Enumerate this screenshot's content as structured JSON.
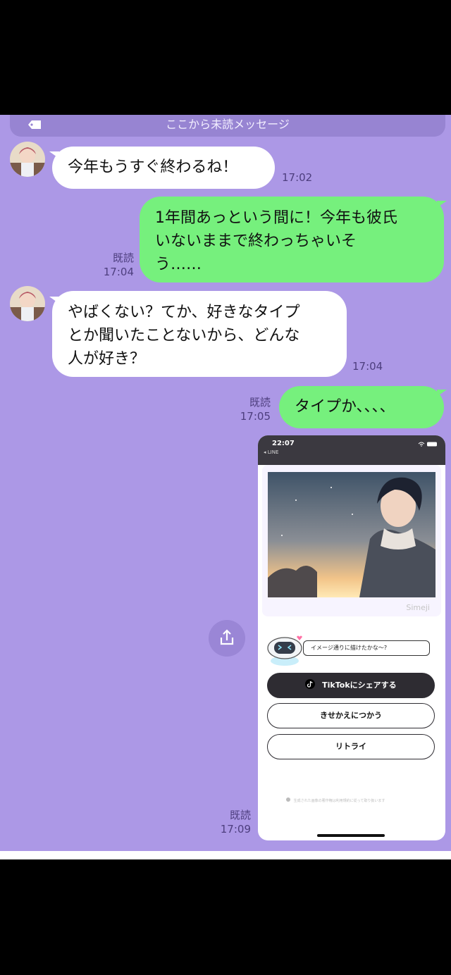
{
  "unread_banner": "ここから未読メッセージ",
  "messages": [
    {
      "text_lines": [
        "今年もうすぐ終わるね！"
      ],
      "time": "17:02"
    },
    {
      "text_lines": [
        "1年間あっという間に！今年も彼氏",
        "いないままで終わっちゃいそ",
        "う……"
      ],
      "read": "既読",
      "time": "17:04"
    },
    {
      "text_lines": [
        "やばくない？てか、好きなタイプ",
        "とか聞いたことないから、どんな",
        "人が好き？"
      ],
      "time": "17:04"
    },
    {
      "text_lines": [
        "タイプか、、、、"
      ],
      "read": "既読",
      "time": "17:05"
    }
  ],
  "screenshot_message": {
    "read": "既読",
    "time": "17:09",
    "status_time": "22:07",
    "back_app": "◂ LINE",
    "watermark": "Simeji",
    "speech": "イメージ通りに描けたかな〜?",
    "buttons": [
      "TikTokにシェアする",
      "きせかえにつかう",
      "リトライ"
    ],
    "footnote": "生成された画像の著作権は利用規約に従って取り扱います"
  },
  "colors": {
    "chat_background": "#ac98e6",
    "outgoing_bubble": "#76f07d",
    "incoming_bubble": "#ffffff",
    "banner": "#9784d2"
  },
  "icons": [
    "tag-icon",
    "share-icon",
    "tiktok-icon",
    "wifi-icon",
    "battery-icon",
    "info-icon"
  ]
}
